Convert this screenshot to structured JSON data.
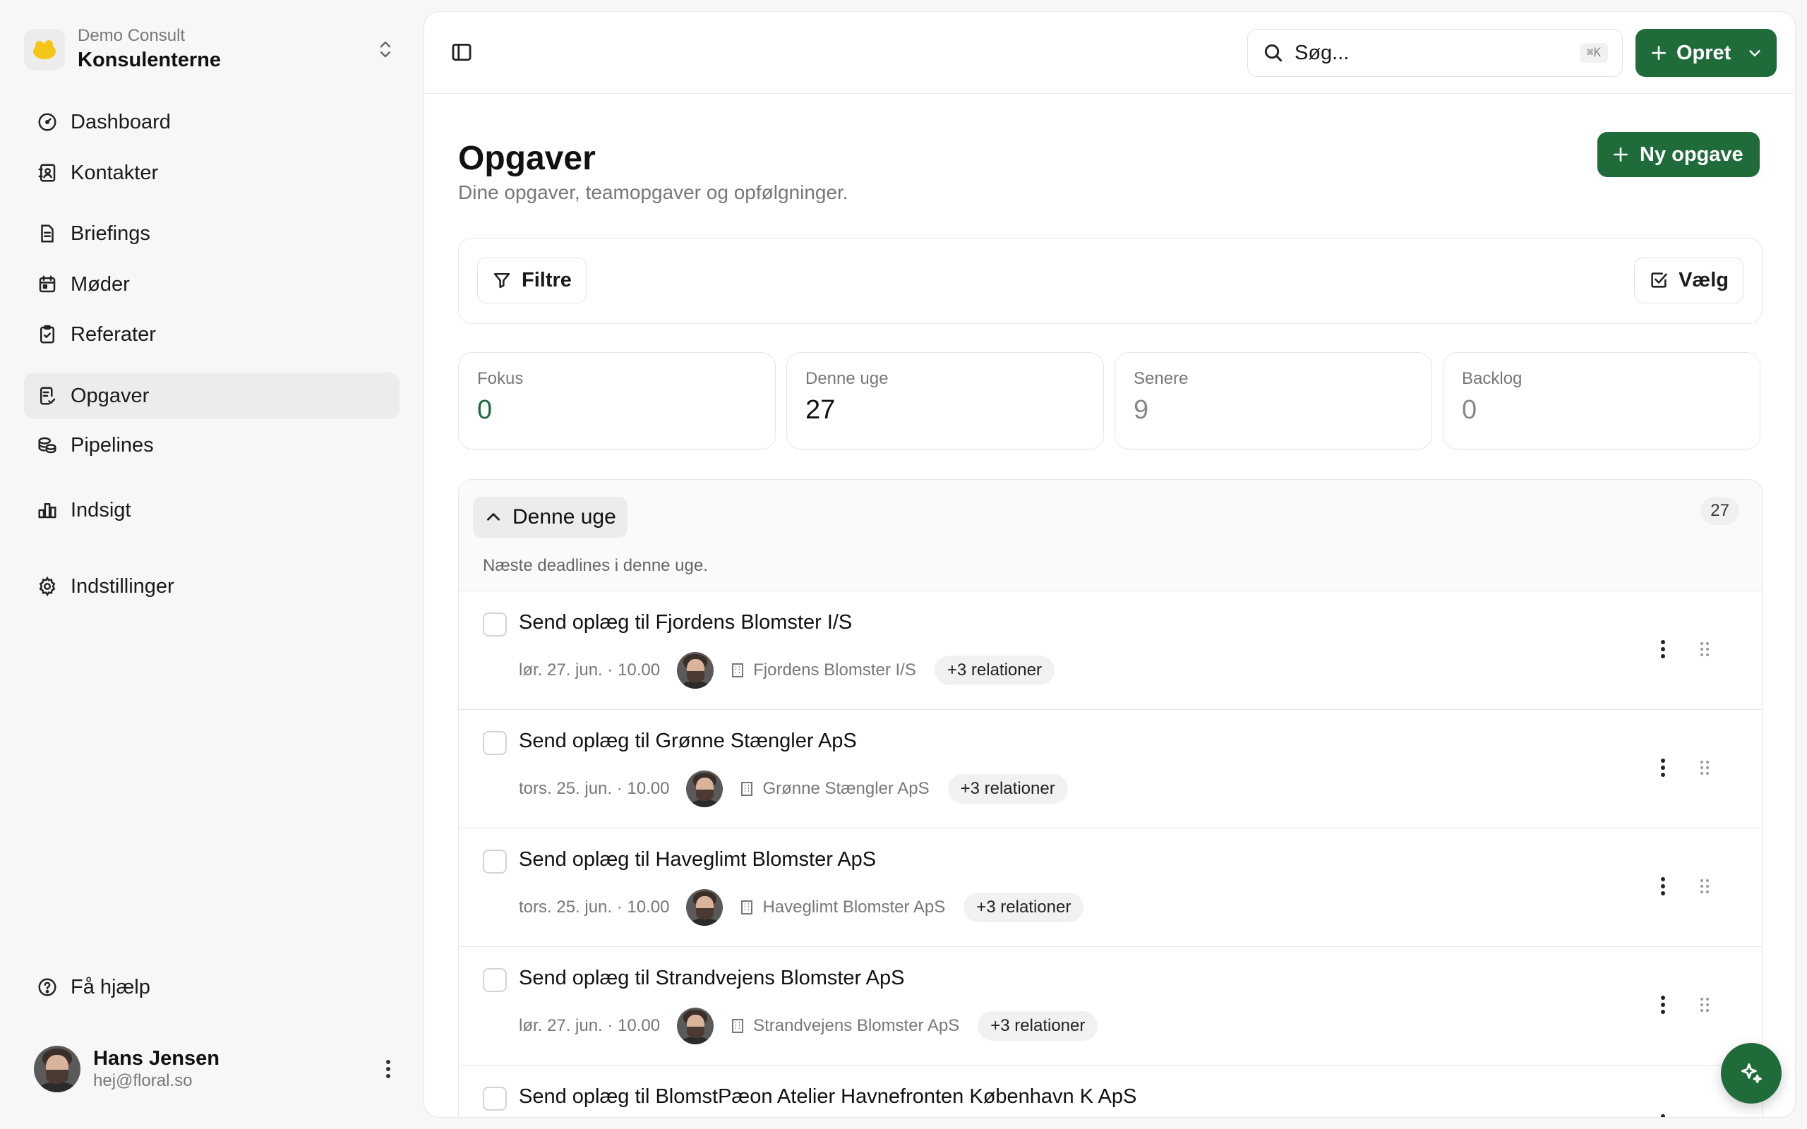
{
  "org": {
    "subtitle": "Demo Consult",
    "name": "Konsulenterne"
  },
  "nav": [
    {
      "label": "Dashboard",
      "icon": "gauge-icon"
    },
    {
      "label": "Kontakter",
      "icon": "contacts-icon"
    },
    {
      "label": "Briefings",
      "icon": "document-icon"
    },
    {
      "label": "Møder",
      "icon": "calendar-icon"
    },
    {
      "label": "Referater",
      "icon": "clipboard-icon"
    },
    {
      "label": "Opgaver",
      "icon": "tasks-icon",
      "active": true
    },
    {
      "label": "Pipelines",
      "icon": "coins-icon"
    },
    {
      "label": "Indsigt",
      "icon": "bar-chart-icon"
    },
    {
      "label": "Indstillinger",
      "icon": "gear-icon"
    }
  ],
  "help": {
    "label": "Få hjælp"
  },
  "user": {
    "name": "Hans Jensen",
    "email": "hej@floral.so"
  },
  "topbar": {
    "search_placeholder": "Søg...",
    "search_shortcut": "⌘K",
    "create_label": "Opret"
  },
  "page": {
    "title": "Opgaver",
    "subtitle": "Dine opgaver, teamopgaver og opfølgninger.",
    "new_task_label": "Ny opgave",
    "filter_label": "Filtre",
    "select_label": "Vælg"
  },
  "stats": [
    {
      "label": "Fokus",
      "value": "0",
      "color": "#1f6b3a"
    },
    {
      "label": "Denne uge",
      "value": "27",
      "color": "#111111"
    },
    {
      "label": "Senere",
      "value": "9",
      "color": "#888888"
    },
    {
      "label": "Backlog",
      "value": "0",
      "color": "#888888"
    }
  ],
  "section": {
    "title": "Denne uge",
    "description": "Næste deadlines i denne uge.",
    "count": "27"
  },
  "tasks": [
    {
      "title": "Send oplæg til Fjordens Blomster I/S",
      "date": "lør. 27. jun. · 10.00",
      "company": "Fjordens Blomster I/S",
      "relations": "+3 relationer"
    },
    {
      "title": "Send oplæg til Grønne Stængler ApS",
      "date": "tors. 25. jun. · 10.00",
      "company": "Grønne Stængler ApS",
      "relations": "+3 relationer"
    },
    {
      "title": "Send oplæg til Haveglimt Blomster ApS",
      "date": "tors. 25. jun. · 10.00",
      "company": "Haveglimt Blomster ApS",
      "relations": "+3 relationer"
    },
    {
      "title": "Send oplæg til Strandvejens Blomster ApS",
      "date": "lør. 27. jun. · 10.00",
      "company": "Strandvejens Blomster ApS",
      "relations": "+3 relationer"
    },
    {
      "title": "Send oplæg til BlomstPæon Atelier Havnefronten København K ApS",
      "date": "",
      "company": "",
      "relations": ""
    }
  ],
  "colors": {
    "accent": "#1f6b3a",
    "logo": "#f5c518"
  }
}
